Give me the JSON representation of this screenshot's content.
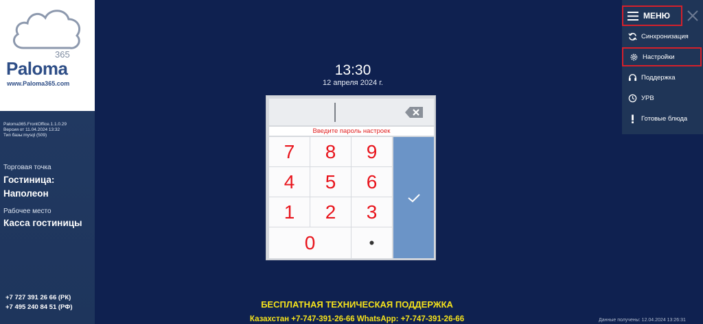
{
  "brand": {
    "number": "365",
    "name": "Paloma",
    "url": "www.Paloma365.com"
  },
  "version_info": {
    "line1": "Paloma365.FrontOffice.1.1.0.29",
    "line2": "Версия от 11.04.2024 13:32",
    "line3": "Тип базы:mysql (509)"
  },
  "location": {
    "point_label": "Торговая точка",
    "point_value": "Гостиница: Наполеон",
    "workplace_label": "Рабочее место",
    "workplace_value": "Касса гостиницы"
  },
  "phones": {
    "kz": "+7 727 391 26 66 (РК)",
    "ru": "+7 495 240 84 51 (РФ)"
  },
  "clock": {
    "time": "13:30",
    "date": "12 апреля 2024 г."
  },
  "keypad": {
    "hint": "Введите пароль настроек",
    "keys": [
      "7",
      "8",
      "9",
      "4",
      "5",
      "6",
      "1",
      "2",
      "3",
      "0",
      "."
    ],
    "dot_display": "•"
  },
  "menu": {
    "title": "МЕНЮ",
    "items": [
      {
        "label": "Синхронизация",
        "icon": "sync-icon"
      },
      {
        "label": "Настройки",
        "icon": "gear-icon",
        "highlighted": true
      },
      {
        "label": "Поддержка",
        "icon": "headset-icon"
      },
      {
        "label": "УРВ",
        "icon": "clock-icon"
      },
      {
        "label": "Готовые блюда",
        "icon": "exclamation-icon"
      }
    ]
  },
  "support": {
    "title": "БЕСПЛАТНАЯ ТЕХНИЧЕСКАЯ ПОДДЕРЖКА",
    "phones": "Казахстан +7-747-391-26-66 WhatsApp: +7-747-391-26-66"
  },
  "footer": {
    "sync": "Данные получены: 12.04.2024 13:26:31"
  },
  "colors": {
    "background": "#0f2150",
    "sidebar": "#1e355c",
    "accent_red": "#d6202a",
    "key_digits": "#e8141c",
    "ok_button": "#6b94c7",
    "support_text": "#f5e21b"
  }
}
